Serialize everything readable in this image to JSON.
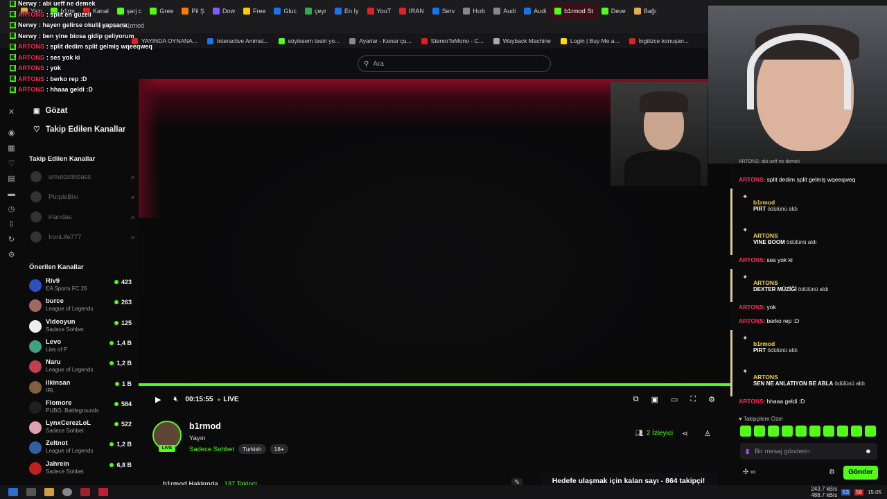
{
  "browser": {
    "tabs": [
      {
        "label": "Yazı",
        "color": "#e0b050"
      },
      {
        "label": "b1rm",
        "color": "#53fc18"
      },
      {
        "label": "Kanal",
        "color": "#e02020"
      },
      {
        "label": "şarj c",
        "color": "#53fc18"
      },
      {
        "label": "Gree",
        "color": "#53fc18"
      },
      {
        "label": "Pil Ş",
        "color": "#ff7a00"
      },
      {
        "label": "Dow",
        "color": "#7a5cff"
      },
      {
        "label": "Free",
        "color": "#ffcc00"
      },
      {
        "label": "Gluc",
        "color": "#1a73e8"
      },
      {
        "label": "çeyr",
        "color": "#34a853"
      },
      {
        "label": "En İy",
        "color": "#1a73e8"
      },
      {
        "label": "YouT",
        "color": "#e02020"
      },
      {
        "label": "İRAN",
        "color": "#e02020"
      },
      {
        "label": "Serv",
        "color": "#1a73e8"
      },
      {
        "label": "Hızlı",
        "color": "#888888"
      },
      {
        "label": "Audi",
        "color": "#888888"
      },
      {
        "label": "Audi",
        "color": "#1a73e8"
      },
      {
        "label": "b1rmod St",
        "color": "#53fc18",
        "active": true
      },
      {
        "label": "Deve",
        "color": "#53fc18"
      },
      {
        "label": "Bağı",
        "color": "#e0b050"
      }
    ],
    "url": "kick.com/b1rmod",
    "bookmarks": [
      {
        "label": "YAYINDA OYNANA...",
        "color": "#e02020"
      },
      {
        "label": "Interactive Animat...",
        "color": "#1a73e8"
      },
      {
        "label": "söylesem tesiri yo...",
        "color": "#53fc18"
      },
      {
        "label": "Ayarlar - Kenar çu...",
        "color": "#888888"
      },
      {
        "label": "StereoToMono - C...",
        "color": "#e02020"
      },
      {
        "label": "Wayback Machine",
        "color": "#aaaaaa"
      },
      {
        "label": "Login | Buy Me a...",
        "color": "#ffdd00"
      },
      {
        "label": "İngilizce konuşan...",
        "color": "#e02020"
      }
    ]
  },
  "search": {
    "placeholder": "Ara"
  },
  "overlay_chat": [
    {
      "user": "Nerwy",
      "color": "white",
      "msg": ": abi ueff ne demek"
    },
    {
      "user": "ARTONS",
      "color": "red",
      "msg": ": split en güzeli"
    },
    {
      "user": "Nerwy",
      "color": "white",
      "msg": ": hayen gelirse okulil yapsana"
    },
    {
      "user": "Nerwy",
      "color": "white",
      "msg": ": ben yine biosa gidip geliyorum"
    },
    {
      "user": "ARTONS",
      "color": "red",
      "msg": ": split dedim split gelmiş wqeeqweq"
    },
    {
      "user": "ARTONS",
      "color": "red",
      "msg": ": ses yok ki"
    },
    {
      "user": "ARTONS",
      "color": "red",
      "msg": ": yok"
    },
    {
      "user": "ARTONS",
      "color": "red",
      "msg": ": berko rep :D"
    },
    {
      "user": "ARTONS",
      "color": "red",
      "msg": ": hhaaa geldi :D"
    }
  ],
  "sidebar": {
    "browse": "Gözat",
    "followed_nav": "Takip Edilen Kanallar",
    "followed_heading": "Takip Edilen Kanallar",
    "followed": [
      {
        "name": "umutcetinbass"
      },
      {
        "name": "PurpleBixi"
      },
      {
        "name": "irlandas"
      },
      {
        "name": "IronLife777"
      }
    ],
    "recommended_heading": "Önerilen Kanallar",
    "recommended": [
      {
        "name": "Riv9",
        "category": "EA Sports FC 26",
        "viewers": "423",
        "color": "#3050c0"
      },
      {
        "name": "burce",
        "category": "League of Legends",
        "viewers": "263",
        "color": "#a06a60"
      },
      {
        "name": "Videoyun",
        "category": "Sadece Sohbet",
        "viewers": "125",
        "color": "#eeeeee"
      },
      {
        "name": "Levo",
        "category": "Lies of P",
        "viewers": "1,4 B",
        "color": "#40a080"
      },
      {
        "name": "Naru",
        "category": "League of Legends",
        "viewers": "1,2 B",
        "color": "#c04050"
      },
      {
        "name": "ilkinsan",
        "category": "IRL",
        "viewers": "1 B",
        "color": "#806040"
      },
      {
        "name": "Flomore",
        "category": "PUBG: Battlegrounds",
        "viewers": "584",
        "color": "#202020"
      },
      {
        "name": "LynxCerezLoL",
        "category": "Sadece Sohbet",
        "viewers": "522",
        "color": "#e0a0b0"
      },
      {
        "name": "Zeltnot",
        "category": "League of Legends",
        "viewers": "1,2 B",
        "color": "#3060a0"
      },
      {
        "name": "Jahrein",
        "category": "Sadece Sohbet",
        "viewers": "6,8 B",
        "color": "#c02020"
      }
    ]
  },
  "player": {
    "time": "00:15:55",
    "live": "LIVE",
    "progress": 1.0
  },
  "channel": {
    "name": "b1rmod",
    "subtitle": "Yayın",
    "category": "Sadece Sohbet",
    "tags": [
      "Turkish",
      "18+"
    ],
    "live_badge": "LIVE",
    "viewers": "2 İzleyici",
    "about": "b1rmod Hakkında",
    "followers": "137 Takipçi",
    "goal": "Hedefe ulaşmak için kalan sayı - 864 takipçi!"
  },
  "chat": {
    "truncated_top": "ARTONS: abi ueff ne demek",
    "items": [
      {
        "type": "msg",
        "user": "ARTONS",
        "text": ": split dedim split gelmiş wqeeqweq"
      },
      {
        "type": "reward",
        "user": "b1rmod",
        "reward": "PIRT",
        "suffix": "ödülünü aldı"
      },
      {
        "type": "reward",
        "user": "ARTONS",
        "reward": "VINE BOOM",
        "suffix": "ödülünü aldı"
      },
      {
        "type": "msg",
        "user": "ARTONS",
        "text": ": ses yok ki"
      },
      {
        "type": "reward",
        "user": "ARTONS",
        "reward": "DEXTER MÜZİĞİ",
        "suffix": "ödülünü aldı"
      },
      {
        "type": "msg",
        "user": "ARTONS",
        "text": ": yok"
      },
      {
        "type": "msg",
        "user": "ARTONS",
        "text": ": berko rep :D"
      },
      {
        "type": "reward",
        "user": "b1rmod",
        "reward": "PIRT",
        "suffix": "ödülünü aldı"
      },
      {
        "type": "reward",
        "user": "ARTONS",
        "reward": "SEN NE ANLATIYON BE ABLA",
        "suffix": "ödülünü aldı"
      },
      {
        "type": "msg",
        "user": "ARTONS",
        "text": ": hhaaa geldi :D"
      }
    ],
    "emote_label": "Takipçilere Özel",
    "input_placeholder": "Bir mesaj gönderin",
    "send_label": "Gönder"
  },
  "taskbar": {
    "net_up": "243.7 kB/s",
    "net_down": "488.7 kB/s",
    "clock": "15:05",
    "badge1": "53",
    "badge2": "56"
  }
}
